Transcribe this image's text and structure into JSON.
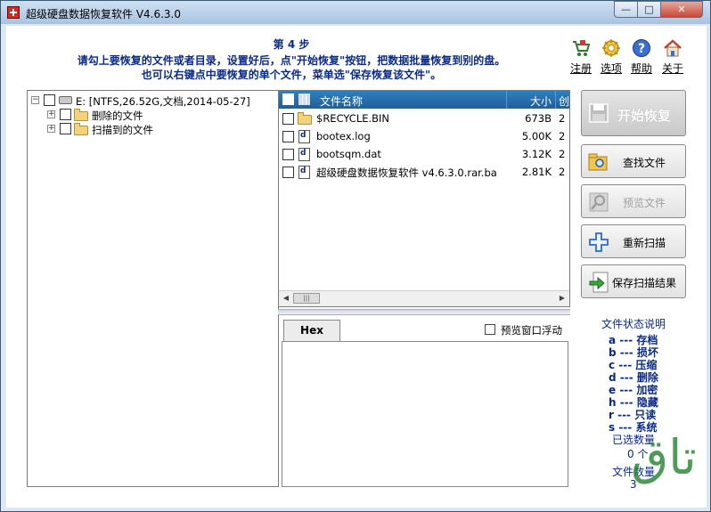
{
  "window": {
    "title": "超级硬盘数据恢复软件 V4.6.3.0",
    "controls": {
      "minimize": "—",
      "maximize": "□",
      "close": "✕"
    }
  },
  "header": {
    "step": "第 4 步",
    "line1": "请勾上要恢复的文件或者目录，设置好后，点\"开始恢复\"按钮，把数据批量恢复到别的盘。",
    "line2": "也可以右键点中要恢复的单个文件，菜单选\"保存恢复该文件\"。"
  },
  "toolbar": [
    {
      "label": "注册",
      "icon": "cart-icon"
    },
    {
      "label": "选项",
      "icon": "gear-icon"
    },
    {
      "label": "帮助",
      "icon": "help-icon"
    },
    {
      "label": "关于",
      "icon": "home-icon"
    }
  ],
  "tree": {
    "root": {
      "label": "E:  [NTFS,26.52G,文档,2014-05-27]",
      "expander": "−"
    },
    "children": [
      {
        "label": "删除的文件",
        "expander": "+"
      },
      {
        "label": "扫描到的文件",
        "expander": "+"
      }
    ]
  },
  "file_list": {
    "columns": {
      "name": "文件名称",
      "size": "大小",
      "attr": "创"
    },
    "rows": [
      {
        "name": "$RECYCLE.BIN",
        "size": "673B",
        "attr": "2",
        "type": "folder"
      },
      {
        "name": "bootex.log",
        "size": "5.00K",
        "attr": "2",
        "type": "d",
        "icon_letter": "d"
      },
      {
        "name": "bootsqm.dat",
        "size": "3.12K",
        "attr": "2",
        "type": "d",
        "icon_letter": "d"
      },
      {
        "name": "超级硬盘数据恢复软件 v4.6.3.0.rar.ba",
        "size": "2.81K",
        "attr": "2",
        "type": "d",
        "icon_letter": "d"
      }
    ],
    "scroll_left": "◀",
    "scroll_right": "▶",
    "scroll_thumb": "|||"
  },
  "preview": {
    "tab": "Hex",
    "float_label": "预览窗口浮动"
  },
  "buttons": {
    "start": "开始恢复",
    "find": "查找文件",
    "preview": "预览文件",
    "rescan": "重新扫描",
    "save_results": "保存扫描结果"
  },
  "legend": {
    "title": "文件状态说明",
    "items": [
      "a --- 存档",
      "b --- 损坏",
      "c --- 压缩",
      "d --- 删除",
      "e --- 加密",
      "h --- 隐藏",
      "r --- 只读",
      "s --- 系统"
    ],
    "selected_label": "已选数量",
    "selected_value": "0 个",
    "file_count_label": "文件数量",
    "file_count_value": "3"
  },
  "watermark": "تاق"
}
